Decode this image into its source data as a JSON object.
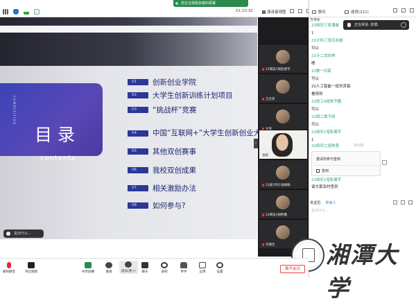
{
  "topbar": {
    "share_banner": "您正在观看张斌的屏幕",
    "time": "01:23:32",
    "layout_label": "演讲者视图"
  },
  "slide": {
    "vertical_text": "COMPETITION",
    "title": "目录",
    "subtitle": "contents",
    "items": [
      {
        "num": "01",
        "text": "创新创业学院"
      },
      {
        "num": "02",
        "text": "大学生创新训练计划项目"
      },
      {
        "num": "03",
        "text": "“挑战杯”竞赛"
      },
      {
        "num": "04",
        "text": "中国“互联网+”大学生创新创业大赛"
      },
      {
        "num": "05",
        "text": "其他双创赛事"
      },
      {
        "num": "06",
        "text": "我校双创成果"
      },
      {
        "num": "07",
        "text": "相关激励办法"
      },
      {
        "num": "08",
        "text": "如何参与?"
      }
    ],
    "chat_placeholder": "说点什么..."
  },
  "videos": [
    {
      "name": "21网安1增彭蔡宇"
    },
    {
      "name": "王云英"
    },
    {
      "name": "文茵"
    },
    {
      "name": "张斌"
    },
    {
      "name": "22级计科1张娟娟"
    },
    {
      "name": "22网安3胡熙鑫"
    },
    {
      "name": "刘增佳"
    }
  ],
  "chat": {
    "tab_chat": "聊天",
    "tab_members": "成员(211)",
    "speaking": "正在讲话: 张斌;",
    "top_person": "方伟东",
    "messages": [
      {
        "kind": "name",
        "text": "22网安三班潘崔"
      },
      {
        "kind": "text",
        "text": "1"
      },
      {
        "kind": "name",
        "text": "22计科三班闫永超"
      },
      {
        "kind": "text",
        "text": "可以"
      },
      {
        "kind": "name",
        "text": "22计二龙欢林"
      },
      {
        "kind": "text",
        "text": "嗯"
      },
      {
        "kind": "name",
        "text": "22数一归崭"
      },
      {
        "kind": "text",
        "text": "可以"
      },
      {
        "kind": "text",
        "text": "22人工智能一班刘芳韬"
      },
      {
        "kind": "text",
        "text": "看得到"
      },
      {
        "kind": "name",
        "text": "22软工4班陈宇鹏"
      },
      {
        "kind": "text",
        "text": "可以"
      },
      {
        "kind": "name",
        "text": "22网二周子闻"
      },
      {
        "kind": "text",
        "text": "可以"
      },
      {
        "kind": "name",
        "text": "21网安1增彭蔡宇"
      },
      {
        "kind": "text",
        "text": "1"
      }
    ],
    "timestamp": "10:00",
    "after_name": "22网安二班陈勇",
    "notice_title": "邀请你参与签到",
    "notice_btn": "签到",
    "final_name": "21网安1增彭蔡宇",
    "final_text": "请大家及时签到",
    "send_to_label": "发送至:",
    "send_to_value": "所有人",
    "input_placeholder": "说点什么..."
  },
  "toolbar": {
    "mute": "解除静音",
    "video": "开启视频",
    "share": "共享屏幕",
    "invite": "邀请",
    "members": "成员(管+)",
    "chat": "聊天",
    "record": "录制",
    "hand": "举手",
    "apps": "应用",
    "settings": "设置",
    "leave": "离开会议"
  },
  "logo_text": "湘潭大学",
  "colors": {
    "accent_green": "#2aa36a",
    "slide_blue": "#2c3796",
    "leave_red": "#e33333"
  }
}
